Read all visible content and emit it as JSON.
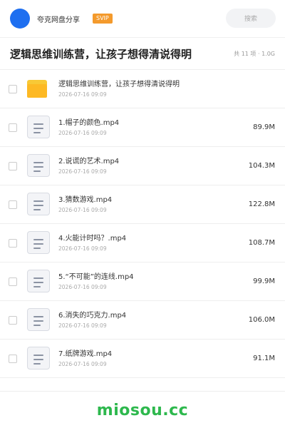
{
  "header": {
    "brand": "夸克网盘分享",
    "badge": "SVIP",
    "search_placeholder": "搜索"
  },
  "share": {
    "title": "逻辑思维训练营，让孩子想得清说得明",
    "meta": "共 11 项 · 1.0G"
  },
  "files": [
    {
      "type": "folder",
      "name": "逻辑思维训练营，让孩子想得清说得明",
      "date": "2026-07-16 09:09",
      "size": ""
    },
    {
      "type": "video",
      "name": "1.帽子的颜色.mp4",
      "date": "2026-07-16 09:09",
      "size": "89.9M"
    },
    {
      "type": "video",
      "name": "2.说谎的艺术.mp4",
      "date": "2026-07-16 09:09",
      "size": "104.3M"
    },
    {
      "type": "video",
      "name": "3.猜数游戏.mp4",
      "date": "2026-07-16 09:09",
      "size": "122.8M"
    },
    {
      "type": "video",
      "name": "4.火能计时吗？.mp4",
      "date": "2026-07-16 09:09",
      "size": "108.7M"
    },
    {
      "type": "video",
      "name": "5.“不可能”的连线.mp4",
      "date": "2026-07-16 09:09",
      "size": "99.9M"
    },
    {
      "type": "video",
      "name": "6.消失的巧克力.mp4",
      "date": "2026-07-16 09:09",
      "size": "106.0M"
    },
    {
      "type": "video",
      "name": "7.纸牌游戏.mp4",
      "date": "2026-07-16 09:09",
      "size": "91.1M"
    }
  ],
  "footer": {
    "watermark": "miosou.cc"
  },
  "colors": {
    "avatar": "#1e6ff0",
    "badge": "#f49a2c",
    "folder": "#fdb924",
    "watermark": "#2db84d"
  }
}
